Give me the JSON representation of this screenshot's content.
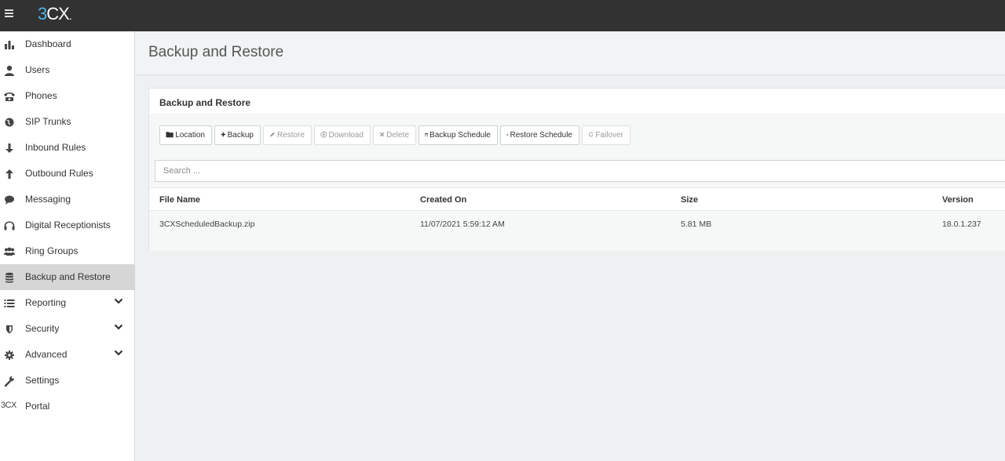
{
  "app": {
    "logo_3": "3",
    "logo_cx": "CX",
    "logo_dot": "."
  },
  "sidebar": {
    "items": [
      {
        "label": "Dashboard",
        "icon": "bar-chart-icon"
      },
      {
        "label": "Users",
        "icon": "user-icon"
      },
      {
        "label": "Phones",
        "icon": "phone-icon"
      },
      {
        "label": "SIP Trunks",
        "icon": "globe-icon"
      },
      {
        "label": "Inbound Rules",
        "icon": "arrow-down-icon"
      },
      {
        "label": "Outbound Rules",
        "icon": "arrow-up-icon"
      },
      {
        "label": "Messaging",
        "icon": "chat-bubble-icon"
      },
      {
        "label": "Digital Receptionists",
        "icon": "headset-icon"
      },
      {
        "label": "Ring Groups",
        "icon": "group-icon"
      },
      {
        "label": "Backup and Restore",
        "icon": "database-icon",
        "active": true
      },
      {
        "label": "Reporting",
        "icon": "list-icon",
        "expandable": true
      },
      {
        "label": "Security",
        "icon": "shield-icon",
        "expandable": true
      },
      {
        "label": "Advanced",
        "icon": "gear-icon",
        "expandable": true
      },
      {
        "label": "Settings",
        "icon": "wrench-icon"
      },
      {
        "label": "Portal",
        "icon": "3cx-icon",
        "icon_text": "3CX"
      }
    ]
  },
  "page": {
    "title": "Backup and Restore"
  },
  "panel": {
    "title": "Backup and Restore"
  },
  "toolbar": {
    "location": "Location",
    "backup": "Backup",
    "restore": "Restore",
    "download": "Download",
    "delete": "Delete",
    "backup_schedule": "Backup Schedule",
    "restore_schedule": "Restore Schedule",
    "failover": "Failover"
  },
  "search": {
    "placeholder": "Search ..."
  },
  "table": {
    "columns": [
      "File Name",
      "Created On",
      "Size",
      "Version"
    ],
    "rows": [
      [
        "3CXScheduledBackup.zip",
        "11/07/2021 5:59:12 AM",
        "5.81 MB",
        "18.0.1.237"
      ]
    ]
  },
  "colors": {
    "topbar": "#323232",
    "logo_accent": "#4ab5e8",
    "active_nav": "#d6d6d6"
  }
}
